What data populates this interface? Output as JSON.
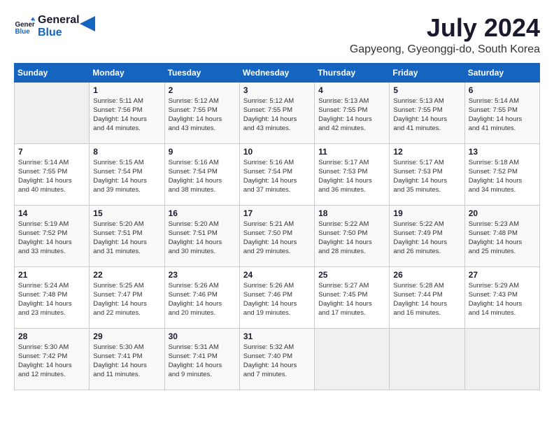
{
  "logo": {
    "line1": "General",
    "line2": "Blue"
  },
  "title": "July 2024",
  "location": "Gapyeong, Gyeonggi-do, South Korea",
  "days_of_week": [
    "Sunday",
    "Monday",
    "Tuesday",
    "Wednesday",
    "Thursday",
    "Friday",
    "Saturday"
  ],
  "weeks": [
    [
      {
        "day": "",
        "info": ""
      },
      {
        "day": "1",
        "info": "Sunrise: 5:11 AM\nSunset: 7:56 PM\nDaylight: 14 hours\nand 44 minutes."
      },
      {
        "day": "2",
        "info": "Sunrise: 5:12 AM\nSunset: 7:55 PM\nDaylight: 14 hours\nand 43 minutes."
      },
      {
        "day": "3",
        "info": "Sunrise: 5:12 AM\nSunset: 7:55 PM\nDaylight: 14 hours\nand 43 minutes."
      },
      {
        "day": "4",
        "info": "Sunrise: 5:13 AM\nSunset: 7:55 PM\nDaylight: 14 hours\nand 42 minutes."
      },
      {
        "day": "5",
        "info": "Sunrise: 5:13 AM\nSunset: 7:55 PM\nDaylight: 14 hours\nand 41 minutes."
      },
      {
        "day": "6",
        "info": "Sunrise: 5:14 AM\nSunset: 7:55 PM\nDaylight: 14 hours\nand 41 minutes."
      }
    ],
    [
      {
        "day": "7",
        "info": "Sunrise: 5:14 AM\nSunset: 7:55 PM\nDaylight: 14 hours\nand 40 minutes."
      },
      {
        "day": "8",
        "info": "Sunrise: 5:15 AM\nSunset: 7:54 PM\nDaylight: 14 hours\nand 39 minutes."
      },
      {
        "day": "9",
        "info": "Sunrise: 5:16 AM\nSunset: 7:54 PM\nDaylight: 14 hours\nand 38 minutes."
      },
      {
        "day": "10",
        "info": "Sunrise: 5:16 AM\nSunset: 7:54 PM\nDaylight: 14 hours\nand 37 minutes."
      },
      {
        "day": "11",
        "info": "Sunrise: 5:17 AM\nSunset: 7:53 PM\nDaylight: 14 hours\nand 36 minutes."
      },
      {
        "day": "12",
        "info": "Sunrise: 5:17 AM\nSunset: 7:53 PM\nDaylight: 14 hours\nand 35 minutes."
      },
      {
        "day": "13",
        "info": "Sunrise: 5:18 AM\nSunset: 7:52 PM\nDaylight: 14 hours\nand 34 minutes."
      }
    ],
    [
      {
        "day": "14",
        "info": "Sunrise: 5:19 AM\nSunset: 7:52 PM\nDaylight: 14 hours\nand 33 minutes."
      },
      {
        "day": "15",
        "info": "Sunrise: 5:20 AM\nSunset: 7:51 PM\nDaylight: 14 hours\nand 31 minutes."
      },
      {
        "day": "16",
        "info": "Sunrise: 5:20 AM\nSunset: 7:51 PM\nDaylight: 14 hours\nand 30 minutes."
      },
      {
        "day": "17",
        "info": "Sunrise: 5:21 AM\nSunset: 7:50 PM\nDaylight: 14 hours\nand 29 minutes."
      },
      {
        "day": "18",
        "info": "Sunrise: 5:22 AM\nSunset: 7:50 PM\nDaylight: 14 hours\nand 28 minutes."
      },
      {
        "day": "19",
        "info": "Sunrise: 5:22 AM\nSunset: 7:49 PM\nDaylight: 14 hours\nand 26 minutes."
      },
      {
        "day": "20",
        "info": "Sunrise: 5:23 AM\nSunset: 7:48 PM\nDaylight: 14 hours\nand 25 minutes."
      }
    ],
    [
      {
        "day": "21",
        "info": "Sunrise: 5:24 AM\nSunset: 7:48 PM\nDaylight: 14 hours\nand 23 minutes."
      },
      {
        "day": "22",
        "info": "Sunrise: 5:25 AM\nSunset: 7:47 PM\nDaylight: 14 hours\nand 22 minutes."
      },
      {
        "day": "23",
        "info": "Sunrise: 5:26 AM\nSunset: 7:46 PM\nDaylight: 14 hours\nand 20 minutes."
      },
      {
        "day": "24",
        "info": "Sunrise: 5:26 AM\nSunset: 7:46 PM\nDaylight: 14 hours\nand 19 minutes."
      },
      {
        "day": "25",
        "info": "Sunrise: 5:27 AM\nSunset: 7:45 PM\nDaylight: 14 hours\nand 17 minutes."
      },
      {
        "day": "26",
        "info": "Sunrise: 5:28 AM\nSunset: 7:44 PM\nDaylight: 14 hours\nand 16 minutes."
      },
      {
        "day": "27",
        "info": "Sunrise: 5:29 AM\nSunset: 7:43 PM\nDaylight: 14 hours\nand 14 minutes."
      }
    ],
    [
      {
        "day": "28",
        "info": "Sunrise: 5:30 AM\nSunset: 7:42 PM\nDaylight: 14 hours\nand 12 minutes."
      },
      {
        "day": "29",
        "info": "Sunrise: 5:30 AM\nSunset: 7:41 PM\nDaylight: 14 hours\nand 11 minutes."
      },
      {
        "day": "30",
        "info": "Sunrise: 5:31 AM\nSunset: 7:41 PM\nDaylight: 14 hours\nand 9 minutes."
      },
      {
        "day": "31",
        "info": "Sunrise: 5:32 AM\nSunset: 7:40 PM\nDaylight: 14 hours\nand 7 minutes."
      },
      {
        "day": "",
        "info": ""
      },
      {
        "day": "",
        "info": ""
      },
      {
        "day": "",
        "info": ""
      }
    ]
  ]
}
